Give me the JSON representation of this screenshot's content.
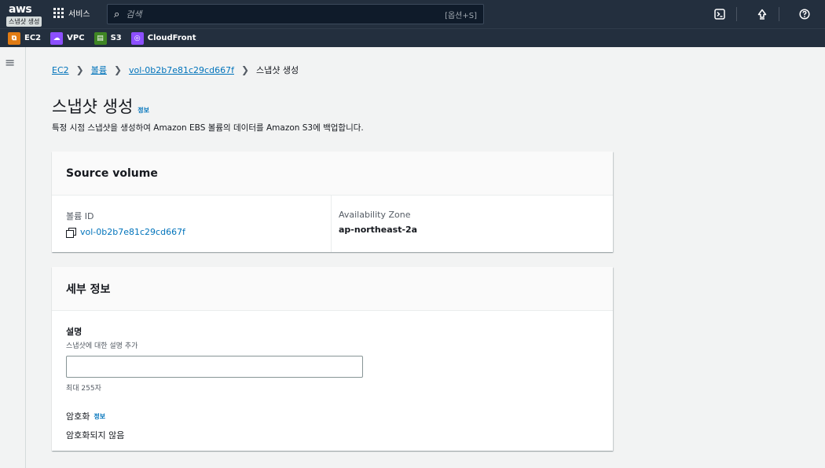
{
  "topnav": {
    "logo_text": "aws",
    "logo_tooltip": "스냅샷 생성",
    "services_label": "서비스",
    "search_placeholder": "검색",
    "search_shortcut": "[옵션+S]",
    "icons": [
      "cloudshell-icon",
      "bell-icon",
      "help-icon"
    ]
  },
  "favorites": [
    {
      "label": "EC2",
      "icon": "ec2-icon",
      "color": "#e07b14"
    },
    {
      "label": "VPC",
      "icon": "vpc-icon",
      "color": "#8c4fff"
    },
    {
      "label": "S3",
      "icon": "s3-icon",
      "color": "#3f8624"
    },
    {
      "label": "CloudFront",
      "icon": "cloudfront-icon",
      "color": "#8c4fff"
    }
  ],
  "breadcrumb": {
    "items": [
      "EC2",
      "볼륨",
      "vol-0b2b7e81c29cd667f"
    ],
    "current": "스냅샷 생성"
  },
  "page": {
    "title": "스냅샷 생성",
    "info": "정보",
    "description": "특정 시점 스냅샷을 생성하여 Amazon EBS 볼륨의 데이터를 Amazon S3에 백업합니다."
  },
  "source_volume": {
    "header": "Source volume",
    "volume_id_label": "볼륨 ID",
    "volume_id": "vol-0b2b7e81c29cd667f",
    "az_label": "Availability Zone",
    "az_value": "ap-northeast-2a"
  },
  "details": {
    "header": "세부 정보",
    "desc_label": "설명",
    "desc_sub": "스냅샷에 대한 설명 추가",
    "desc_value": "",
    "desc_hint": "최대 255자",
    "enc_label": "암호화",
    "enc_info": "정보",
    "enc_value": "암호화되지 않음"
  }
}
